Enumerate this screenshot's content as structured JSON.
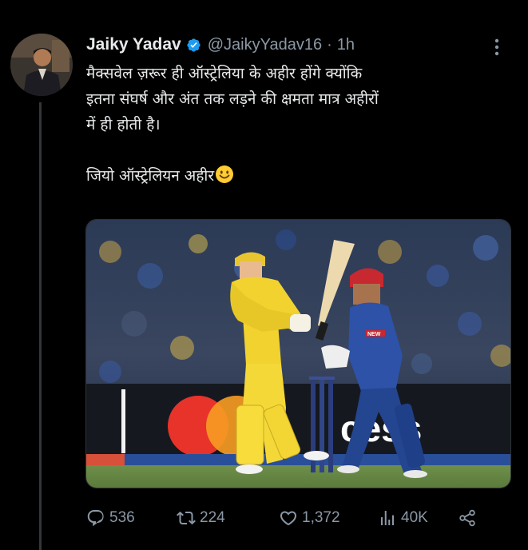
{
  "tweet": {
    "author_name": "Jaiky Yadav",
    "handle": "@JaikyYadav16",
    "separator": "·",
    "time": "1h",
    "text_line1": "मैक्सवेल ज़रूर ही ऑस्ट्रेलिया के अहीर होंगे क्योंकि\nइतना संघर्ष और अंत तक लड़ने की क्षमता मात्र अहीरों\nमें ही होती है।",
    "text_line2": "जियो ऑस्ट्रेलियन अहीर",
    "emoji": "smiling-face-emoji"
  },
  "media": {
    "description_icon": "cricket-photo",
    "banner_text": "cess",
    "wk_jersey_text": "NEW",
    "colors": {
      "yellow_kit": "#f2d22e",
      "blue_kit": "#2d52a8",
      "helmet_red": "#c8282f",
      "banner_red": "#e8332a",
      "banner_orange": "#f59a23"
    }
  },
  "actions": {
    "replies": "536",
    "retweets": "224",
    "likes": "1,372",
    "views": "40K"
  },
  "colors": {
    "background": "#000000",
    "text": "#e7e9ea",
    "secondary": "#8b98a5",
    "verified": "#1d9bf0"
  }
}
